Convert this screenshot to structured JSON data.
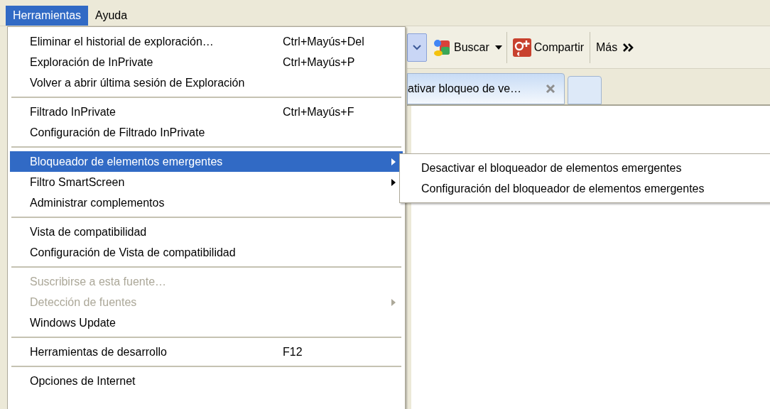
{
  "menubar": [
    {
      "label": "Herramientas",
      "selected": true
    },
    {
      "label": "Ayuda",
      "selected": false
    }
  ],
  "toolbar": {
    "buttons": [
      {
        "kind": "search",
        "label": "Buscar"
      },
      {
        "kind": "share",
        "label": "Compartir"
      },
      {
        "kind": "more",
        "label": "Más"
      }
    ]
  },
  "tab": {
    "title": "ativar bloqueo de ve…"
  },
  "menu": {
    "items": [
      {
        "kind": "item",
        "label": "Eliminar el historial de exploración…",
        "shortcut": "Ctrl+Mayús+Del",
        "disabled": false,
        "selected": false,
        "has_submenu": false
      },
      {
        "kind": "item",
        "label": "Exploración de InPrivate",
        "shortcut": "Ctrl+Mayús+P",
        "disabled": false,
        "selected": false,
        "has_submenu": false
      },
      {
        "kind": "item",
        "label": "Volver a abrir última sesión de Exploración",
        "disabled": false,
        "selected": false,
        "has_submenu": false
      },
      {
        "kind": "separator"
      },
      {
        "kind": "item",
        "label": "Filtrado InPrivate",
        "shortcut": "Ctrl+Mayús+F",
        "disabled": false,
        "selected": false,
        "has_submenu": false
      },
      {
        "kind": "item",
        "label": "Configuración de Filtrado InPrivate",
        "disabled": false,
        "selected": false,
        "has_submenu": false
      },
      {
        "kind": "separator"
      },
      {
        "kind": "item",
        "label": "Bloqueador de elementos emergentes",
        "disabled": false,
        "selected": true,
        "has_submenu": true
      },
      {
        "kind": "item",
        "label": "Filtro SmartScreen",
        "disabled": false,
        "selected": false,
        "has_submenu": true
      },
      {
        "kind": "item",
        "label": "Administrar complementos",
        "disabled": false,
        "selected": false,
        "has_submenu": false
      },
      {
        "kind": "separator"
      },
      {
        "kind": "item",
        "label": "Vista de compatibilidad",
        "disabled": false,
        "selected": false,
        "has_submenu": false
      },
      {
        "kind": "item",
        "label": "Configuración de Vista de compatibilidad",
        "disabled": false,
        "selected": false,
        "has_submenu": false
      },
      {
        "kind": "separator"
      },
      {
        "kind": "item",
        "label": "Suscribirse a esta fuente…",
        "disabled": true,
        "selected": false,
        "has_submenu": false
      },
      {
        "kind": "item",
        "label": "Detección de fuentes",
        "disabled": true,
        "selected": false,
        "has_submenu": true
      },
      {
        "kind": "item",
        "label": "Windows Update",
        "disabled": false,
        "selected": false,
        "has_submenu": false
      },
      {
        "kind": "separator"
      },
      {
        "kind": "item",
        "label": "Herramientas de desarrollo",
        "shortcut": "F12",
        "disabled": false,
        "selected": false,
        "has_submenu": false
      },
      {
        "kind": "separator"
      },
      {
        "kind": "item",
        "label": "Opciones de Internet",
        "disabled": false,
        "selected": false,
        "has_submenu": false
      }
    ]
  },
  "submenu": {
    "items": [
      {
        "label": "Desactivar el bloqueador de elementos emergentes"
      },
      {
        "label": "Configuración del bloqueador de elementos emergentes"
      }
    ]
  }
}
